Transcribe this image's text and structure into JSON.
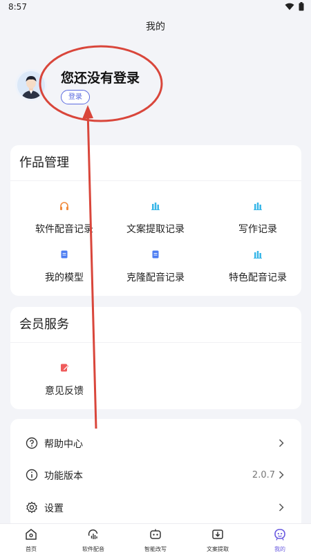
{
  "status_bar": {
    "time": "8:57"
  },
  "header": {
    "title": "我的"
  },
  "profile": {
    "prompt": "您还没有登录",
    "login_label": "登录"
  },
  "works_card": {
    "title": "作品管理",
    "items": [
      {
        "label": "软件配音记录",
        "icon": "headphones-icon",
        "color": "#f08a3c"
      },
      {
        "label": "文案提取记录",
        "icon": "bar-chart-icon",
        "color": "#39b7e8"
      },
      {
        "label": "写作记录",
        "icon": "bar-chart-icon",
        "color": "#39b7e8"
      },
      {
        "label": "我的模型",
        "icon": "document-icon",
        "color": "#4d7df2"
      },
      {
        "label": "克隆配音记录",
        "icon": "document-icon",
        "color": "#4d7df2"
      },
      {
        "label": "特色配音记录",
        "icon": "bar-chart-icon",
        "color": "#39b7e8"
      }
    ]
  },
  "vip_card": {
    "title": "会员服务",
    "items": [
      {
        "label": "意见反馈",
        "icon": "feedback-icon",
        "color": "#ef5b5b"
      }
    ]
  },
  "menu": {
    "items": [
      {
        "label": "帮助中心",
        "icon": "help-icon",
        "value": ""
      },
      {
        "label": "功能版本",
        "icon": "info-icon",
        "value": "2.0.7"
      },
      {
        "label": "设置",
        "icon": "gear-icon",
        "value": ""
      }
    ]
  },
  "tab_bar": {
    "items": [
      {
        "label": "首页",
        "icon": "home-icon",
        "active": false
      },
      {
        "label": "软件配音",
        "icon": "voice-icon",
        "active": false
      },
      {
        "label": "智能改写",
        "icon": "robot-icon",
        "active": false
      },
      {
        "label": "文案提取",
        "icon": "download-box-icon",
        "active": false
      },
      {
        "label": "我的",
        "icon": "user-face-icon",
        "active": true
      }
    ],
    "active_color": "#6a5be0"
  },
  "colors": {
    "accent": "#5a6adf",
    "annotation": "#d9463b"
  }
}
